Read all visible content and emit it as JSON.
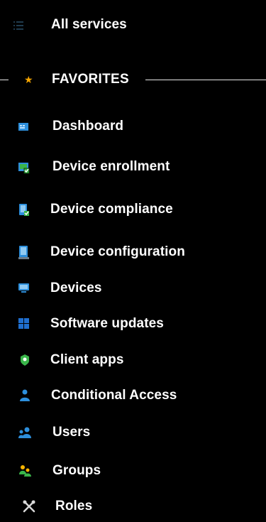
{
  "nav": {
    "all_services": {
      "label": "All services",
      "icon": "list-icon"
    },
    "favorites_header": {
      "label": "FAVORITES",
      "icon": "star-icon"
    },
    "items": [
      {
        "label": "Dashboard",
        "icon": "dashboard-icon"
      },
      {
        "label": "Device enrollment",
        "icon": "device-enrollment-icon"
      },
      {
        "label": "Device compliance",
        "icon": "device-compliance-icon"
      },
      {
        "label": "Device configuration",
        "icon": "device-configuration-icon"
      },
      {
        "label": "Devices",
        "icon": "devices-icon"
      },
      {
        "label": "Software updates",
        "icon": "software-updates-icon"
      },
      {
        "label": "Client apps",
        "icon": "client-apps-icon"
      },
      {
        "label": "Conditional Access",
        "icon": "conditional-access-icon"
      },
      {
        "label": "Users",
        "icon": "users-icon"
      },
      {
        "label": "Groups",
        "icon": "groups-icon"
      },
      {
        "label": "Roles",
        "icon": "roles-icon"
      }
    ]
  },
  "colors": {
    "background": "#000000",
    "text": "#ffffff",
    "star": "#f6a600",
    "icon_blue": "#2d8fdc",
    "icon_green": "#3ab54a"
  }
}
